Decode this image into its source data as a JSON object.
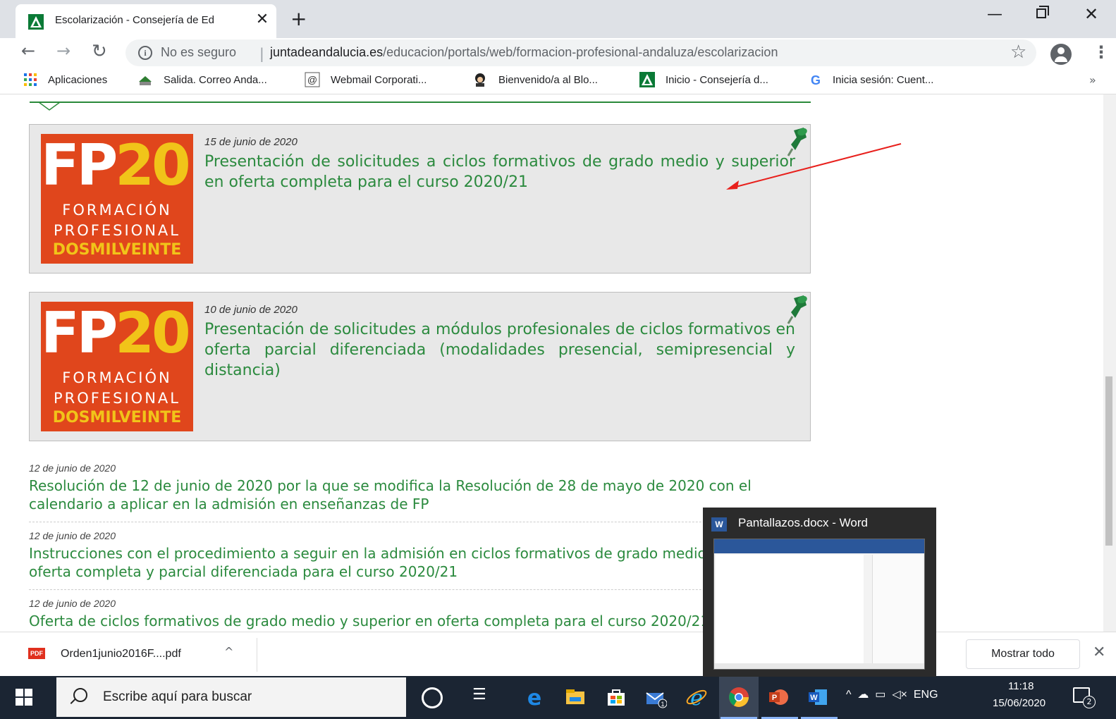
{
  "browser": {
    "tab_title": "Escolarización - Consejería de Ed",
    "tab_close": "✕",
    "new_tab": "+",
    "security_label": "No es seguro",
    "separator": "|",
    "url_host": "juntadeandalucia.es",
    "url_path": "/educacion/portals/web/formacion-profesional-andaluza/escolarizacion",
    "bookmarks": [
      {
        "label": "Aplicaciones",
        "icon": "apps-grid-icon"
      },
      {
        "label": "Salida. Correo Anda...",
        "icon": "mail-outbox-icon"
      },
      {
        "label": "Webmail Corporati...",
        "icon": "at-sign-icon"
      },
      {
        "label": "Bienvenido/a al Blo...",
        "icon": "avatar-icon"
      },
      {
        "label": "Inicio - Consejería d...",
        "icon": "junta-andalucia-icon"
      },
      {
        "label": "Inicia sesión: Cuent...",
        "icon": "google-icon"
      }
    ],
    "bookmarks_more": "»"
  },
  "content": {
    "logo": {
      "fp": "FP",
      "number": "20",
      "line1": "FORMACIÓN",
      "line2": "PROFESIONAL",
      "line3": "DOSMILVEINTE"
    },
    "featured": [
      {
        "date": "15 de junio de 2020",
        "title": "Presentación de solicitudes a ciclos formativos de grado medio y superior en oferta completa para el curso 2020/21"
      },
      {
        "date": "10 de junio de 2020",
        "title": "Presentación de solicitudes a módulos profesionales de ciclos formativos en oferta parcial diferenciada (modalidades presencial, semipresencial y distancia)"
      }
    ],
    "news": [
      {
        "date": "12 de junio de 2020",
        "title": "Resolución de 12 de junio de 2020 por la que se modifica la Resolución de 28 de mayo de 2020 con el calendario a aplicar en la admisión en enseñanzas de FP"
      },
      {
        "date": "12 de junio de 2020",
        "title": "Instrucciones con el procedimiento a seguir en la admisión en ciclos formativos de grado medio y superior en oferta completa y parcial diferenciada para el curso 2020/21"
      },
      {
        "date": "12 de junio de 2020",
        "title": "Oferta de ciclos formativos de grado medio y superior en oferta completa para el curso 2020/21"
      }
    ],
    "annotation_color": "#e8201c"
  },
  "downloads": {
    "pdf_badge": "PDF",
    "file_name": "Orden1junio2016F....pdf",
    "chevron": "^",
    "show_all": "Mostrar todo",
    "close": "✕"
  },
  "taskbar": {
    "search_placeholder": "Escribe aquí para buscar",
    "tray_language": "ENG",
    "time": "11:18",
    "date": "15/06/2020",
    "notification_count": "2",
    "mail_badge": "1"
  },
  "word_preview": {
    "icon_letter": "W",
    "title": "Pantallazos.docx - Word"
  }
}
